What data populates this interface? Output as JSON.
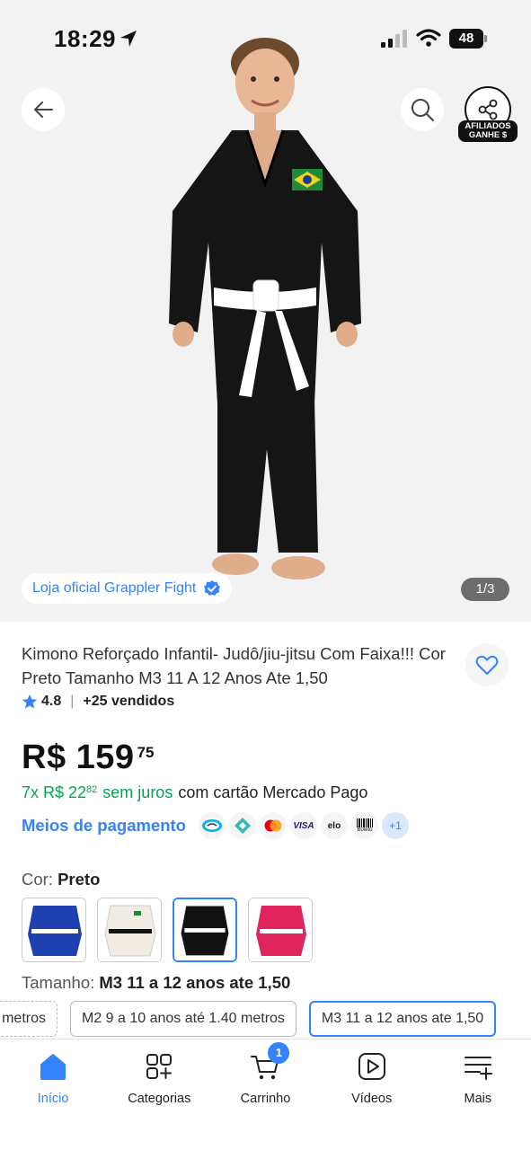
{
  "status_bar": {
    "time": "18:29",
    "battery": "48"
  },
  "header": {
    "affiliate_line1": "AFILIADOS",
    "affiliate_line2": "GANHE $"
  },
  "gallery": {
    "store_badge": "Loja oficial Grappler Fight",
    "image_counter": "1/3"
  },
  "product": {
    "title": "Kimono Reforçado Infantil- Judô/jiu-jitsu Com Faixa!!! Cor Preto Tamanho M3 11 A 12 Anos Ate 1,50",
    "rating": "4.8",
    "sold": "+25 vendidos",
    "price_main": "R$ 159",
    "price_cents": "75",
    "installment_prefix": "7x R$ 22",
    "installment_cents": "82",
    "installment_interest": "sem juros",
    "installment_suffix": "com cartão Mercado Pago",
    "payment_link": "Meios de pagamento",
    "payment_methods": [
      "Mercado Pago",
      "Pix",
      "Mastercard",
      "VISA",
      "elo",
      "Boleto"
    ],
    "payment_more": "+1"
  },
  "color": {
    "label": "Cor:",
    "selected": "Preto",
    "options": [
      "Azul",
      "Branco",
      "Preto",
      "Rosa"
    ],
    "swatch_colors": [
      "#1e40b0",
      "#f1ede4",
      "#111111",
      "#e0245e"
    ]
  },
  "size": {
    "label": "Tamanho:",
    "selected": "M3 11 a 12 anos ate 1,50",
    "options": [
      "metros",
      "M2 9 a 10 anos até 1.40 metros",
      "M3 11 a 12 anos ate 1,50"
    ]
  },
  "nav": {
    "items": [
      {
        "label": "Início",
        "icon": "home-icon"
      },
      {
        "label": "Categorias",
        "icon": "categories-icon"
      },
      {
        "label": "Carrinho",
        "icon": "cart-icon"
      },
      {
        "label": "Vídeos",
        "icon": "video-icon"
      },
      {
        "label": "Mais",
        "icon": "menu-icon"
      }
    ],
    "cart_count": "1"
  },
  "colors": {
    "accent": "#3483fa",
    "green": "#00a650"
  }
}
